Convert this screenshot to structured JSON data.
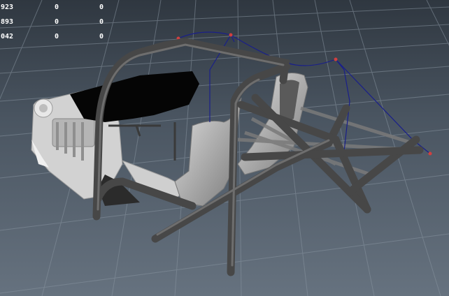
{
  "viewport": {
    "grid_color": "#7f8a96",
    "horizon_color": "#2f3740",
    "floor_color": "#66727f",
    "curve_color": "#1a1f8a",
    "curve_point_color": "#d04040",
    "cage_color": "#4a4a4a",
    "model_color": "#c8c8c8"
  },
  "readout": {
    "rows": [
      {
        "a": "923",
        "b": "0",
        "c": "0"
      },
      {
        "a": "893",
        "b": "0",
        "c": "0"
      },
      {
        "a": "042",
        "b": "0",
        "c": "0"
      }
    ]
  }
}
